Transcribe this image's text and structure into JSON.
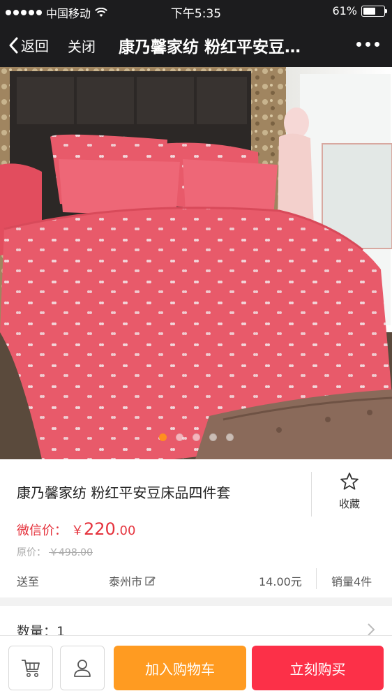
{
  "status_bar": {
    "carrier": "中国移动",
    "time": "下午5:35",
    "battery": "61%",
    "battery_level": 0.61
  },
  "nav": {
    "back_label": "返回",
    "close_label": "关闭",
    "title": "康乃馨家纺 粉红平安豆…",
    "more_icon": "more-dots-icon"
  },
  "gallery": {
    "image_count": 5,
    "active_index": 0
  },
  "product": {
    "title": "康乃馨家纺 粉红平安豆床品四件套",
    "favorite_label": "收藏",
    "favorite_icon": "star-outline-icon",
    "price_label": "微信价：",
    "price_currency": "￥",
    "price_integer": "220",
    "price_decimal": ".00",
    "price_color": "#e5333d",
    "original_label": "原价：",
    "original_price": "￥498.00"
  },
  "shipping": {
    "ship_to_label": "送至",
    "city": "泰州市",
    "fee": "14.00元",
    "sales": "销量4件"
  },
  "quantity": {
    "label": "数量：",
    "value": "1"
  },
  "bottom_bar": {
    "cart_icon": "cart-icon",
    "user_icon": "user-icon",
    "add_to_cart": "加入购物车",
    "buy_now": "立刻购买",
    "add_color": "#ff9b21",
    "buy_color": "#fc3048"
  }
}
